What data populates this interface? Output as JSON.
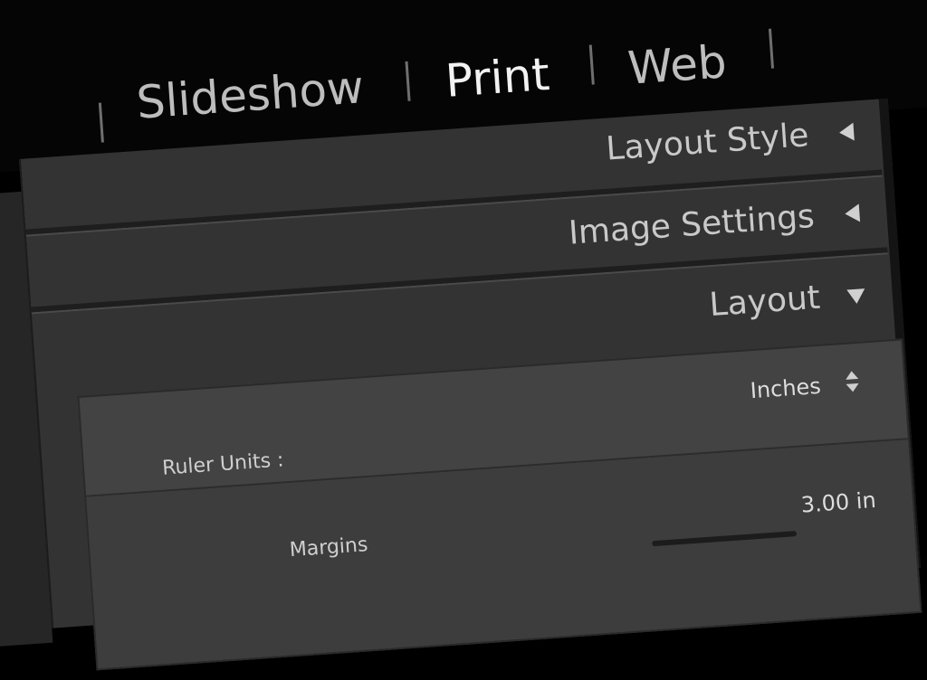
{
  "modules": {
    "items": [
      {
        "label": "Slideshow",
        "active": false
      },
      {
        "label": "Print",
        "active": true
      },
      {
        "label": "Web",
        "active": false
      }
    ]
  },
  "panels": {
    "layout_style": {
      "label": "Layout Style",
      "state": "collapsed",
      "icon": "triangle-left-icon"
    },
    "image_settings": {
      "label": "Image Settings",
      "state": "collapsed",
      "icon": "triangle-left-icon"
    },
    "layout": {
      "label": "Layout",
      "state": "expanded",
      "icon": "triangle-down-icon"
    }
  },
  "layout": {
    "ruler_units_label": "Ruler Units :",
    "ruler_units_value": "Inches",
    "margins_label": "Margins",
    "margins_value": "3.00 in"
  },
  "colors": {
    "background": "#000000",
    "panel": "#333333",
    "content": "#434343",
    "text": "#c9c9c9",
    "active_text": "#f2f2f2"
  }
}
